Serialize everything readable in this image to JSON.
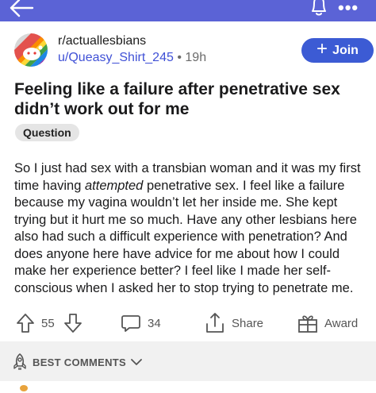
{
  "topbar": {
    "background": "#5b63d6",
    "back_icon": "arrow-left-icon",
    "bell_icon": "bell-icon",
    "more_icon": "more-horizontal-icon",
    "more_glyph": "•••"
  },
  "post": {
    "subreddit": "r/actuallesbians",
    "author": "u/Queasy_Shirt_245",
    "separator": "•",
    "age": "19h",
    "join_label": "Join",
    "join_plus": "+",
    "title": "Feeling like a failure after penetrative sex didn’t work out for me",
    "flair": "Question",
    "body_before_em": "So I just had sex with a transbian woman and it was my first time having ",
    "body_em": "attempted",
    "body_after_em": " penetrative sex. I feel like a failure because my vagina wouldn’t let her inside me. She kept trying but it hurt me so much. Have any other lesbians here also had such a difficult experience with penetration? And does anyone here have advice for me about how I could make her experience better? I feel like I made her self-conscious when I asked her to stop trying to penetrate me."
  },
  "actions": {
    "vote_count": "55",
    "comment_count": "34",
    "share_label": "Share",
    "award_label": "Award"
  },
  "comments": {
    "sort_label": "BEST COMMENTS"
  },
  "colors": {
    "accent": "#3c5bd4",
    "username": "#3f50d6"
  }
}
